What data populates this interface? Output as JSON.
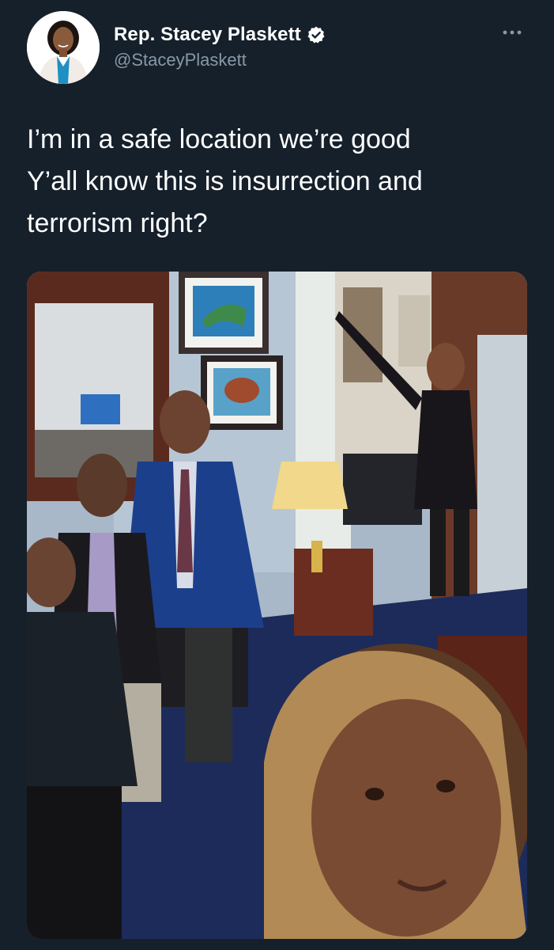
{
  "author": {
    "display_name": "Rep. Stacey Plaskett",
    "handle": "@StaceyPlaskett",
    "verified": true,
    "avatar_icon": "profile-photo"
  },
  "tweet": {
    "lines": [
      "I’m in a safe location we’re good",
      "Y’all know this is insurrection and",
      "terrorism right?"
    ]
  },
  "actions": {
    "more_icon": "more-horizontal-icon"
  },
  "media": {
    "type": "photo",
    "description_icon": "selfie-photo"
  },
  "colors": {
    "background": "#15202b",
    "text": "#ffffff",
    "secondary_text": "#8899a6",
    "verified_badge": "#ffffff"
  }
}
